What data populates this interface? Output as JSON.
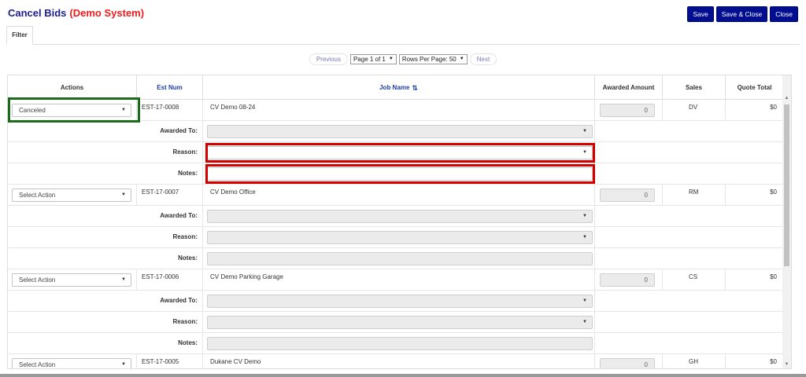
{
  "header": {
    "title": "Cancel Bids",
    "subtitle": "(Demo System)",
    "buttons": {
      "save": "Save",
      "save_close": "Save & Close",
      "close": "Close"
    }
  },
  "tabs": {
    "filter": "Filter"
  },
  "pager": {
    "previous": "Previous",
    "page": "Page 1 of 1",
    "rows_per_page": "Rows Per Page: 50",
    "next": "Next"
  },
  "columns": {
    "actions": "Actions",
    "est_num": "Est Num",
    "job_name": "Job Name",
    "awarded_amount": "Awarded Amount",
    "sales": "Sales",
    "quote_total": "Quote Total"
  },
  "labels": {
    "awarded_to": "Awarded To:",
    "reason": "Reason:",
    "notes": "Notes:"
  },
  "bids": [
    {
      "action": "Canceled",
      "est_num": "EST-17-0008",
      "job_name": "CV Demo 08-24",
      "awarded_amount": "0",
      "sales": "DV",
      "quote_total": "$0"
    },
    {
      "action": "Select Action",
      "est_num": "EST-17-0007",
      "job_name": "CV Demo Office",
      "awarded_amount": "0",
      "sales": "RM",
      "quote_total": "$0"
    },
    {
      "action": "Select Action",
      "est_num": "EST-17-0006",
      "job_name": "CV Demo Parking Garage",
      "awarded_amount": "0",
      "sales": "CS",
      "quote_total": "$0"
    },
    {
      "action": "Select Action",
      "est_num": "EST-17-0005",
      "job_name": "Dukane CV Demo",
      "awarded_amount": "0",
      "sales": "GH",
      "quote_total": "$0"
    }
  ],
  "colors": {
    "brand_blue": "#000e8f",
    "title_blue": "#1d1d8f",
    "demo_red": "#ee1c1c",
    "highlight_green": "#1b6b1b",
    "highlight_red": "#d40000"
  }
}
